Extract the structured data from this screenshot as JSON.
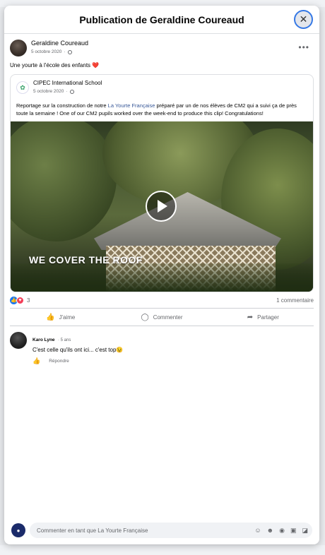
{
  "modal": {
    "title": "Publication de Geraldine Coureaud",
    "close_icon": "✕"
  },
  "post": {
    "author": "Geraldine Coureaud",
    "date": "5 octobre 2020",
    "more_icon": "•••",
    "text": "Une yourte à l'école des enfants",
    "heart": "❤️"
  },
  "shared": {
    "page_name": "CIPEC International School",
    "date": "5 octobre 2020",
    "text_before": "Reportage sur la construction de notre ",
    "link_text": "La Yourte Française",
    "text_after": " préparé par un de nos élèves de CM2 qui a suivi ça de près toute la semaine !  One of our CM2 pupils worked over the week-end to produce this clip! Congratulations!",
    "video_caption": "WE COVER THE ROOF"
  },
  "stats": {
    "reactions_count": "3",
    "comments_count": "1 commentaire"
  },
  "actions": {
    "like": "J'aime",
    "comment": "Commenter",
    "share": "Partager"
  },
  "comment": {
    "author": "Karo Lyne",
    "time": "5 ans",
    "text": "C'est celle qu'ils ont ici... c'est top😉",
    "reply": "Répondre"
  },
  "composer": {
    "placeholder": "Commenter en tant que La Yourte Française"
  },
  "colors": {
    "accent": "#1877f2",
    "link": "#385898",
    "love": "#f33e58"
  }
}
